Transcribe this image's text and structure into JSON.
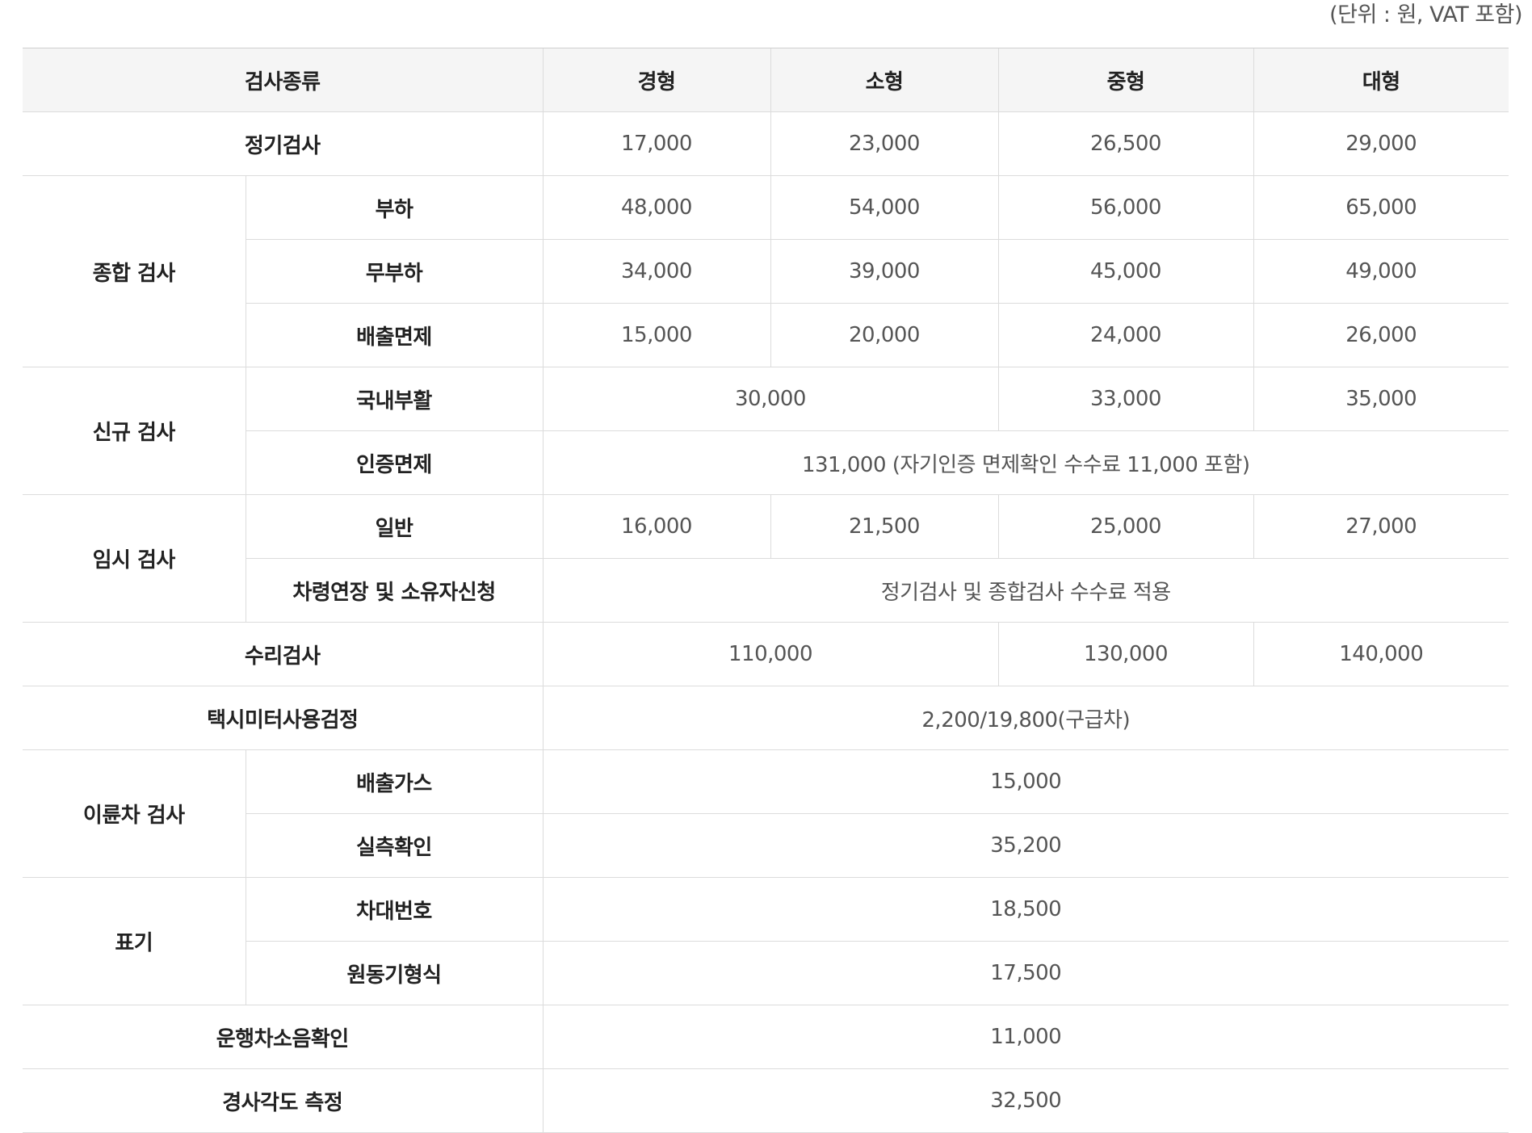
{
  "unit_note": "(단위 : 원, VAT 포함)",
  "header": {
    "type": "검사종류",
    "light": "경형",
    "small": "소형",
    "medium": "중형",
    "large": "대형"
  },
  "rows": {
    "regular": {
      "label": "정기검사",
      "values": [
        "17,000",
        "23,000",
        "26,500",
        "29,000"
      ]
    },
    "comprehensive": {
      "label": "종합 검사",
      "load": {
        "label": "부하",
        "values": [
          "48,000",
          "54,000",
          "56,000",
          "65,000"
        ]
      },
      "noload": {
        "label": "무부하",
        "values": [
          "34,000",
          "39,000",
          "45,000",
          "49,000"
        ]
      },
      "exempt": {
        "label": "배출면제",
        "values": [
          "15,000",
          "20,000",
          "24,000",
          "26,000"
        ]
      }
    },
    "new": {
      "label": "신규 검사",
      "domestic": {
        "label": "국내부활",
        "light_small": "30,000",
        "medium": "33,000",
        "large": "35,000"
      },
      "cert_exempt": {
        "label": "인증면제",
        "value": "131,000 (자기인증 면제확인 수수료 11,000 포함)"
      }
    },
    "temporary": {
      "label": "임시 검사",
      "general": {
        "label": "일반",
        "values": [
          "16,000",
          "21,500",
          "25,000",
          "27,000"
        ]
      },
      "extension": {
        "label": "차령연장 및 소유자신청",
        "value": "정기검사 및 종합검사 수수료 적용"
      }
    },
    "repair": {
      "label": "수리검사",
      "light_small": "110,000",
      "medium": "130,000",
      "large": "140,000"
    },
    "taxi": {
      "label": "택시미터사용검정",
      "value": "2,200/19,800(구급차)"
    },
    "two_wheel": {
      "label": "이륜차 검사",
      "emission": {
        "label": "배출가스",
        "value": "15,000"
      },
      "measure": {
        "label": "실측확인",
        "value": "35,200"
      }
    },
    "marking": {
      "label": "표기",
      "chassis": {
        "label": "차대번호",
        "value": "18,500"
      },
      "engine": {
        "label": "원동기형식",
        "value": "17,500"
      }
    },
    "noise": {
      "label": "운행차소음확인",
      "value": "11,000"
    },
    "slope": {
      "label": "경사각도 측정",
      "value": "32,500"
    }
  }
}
